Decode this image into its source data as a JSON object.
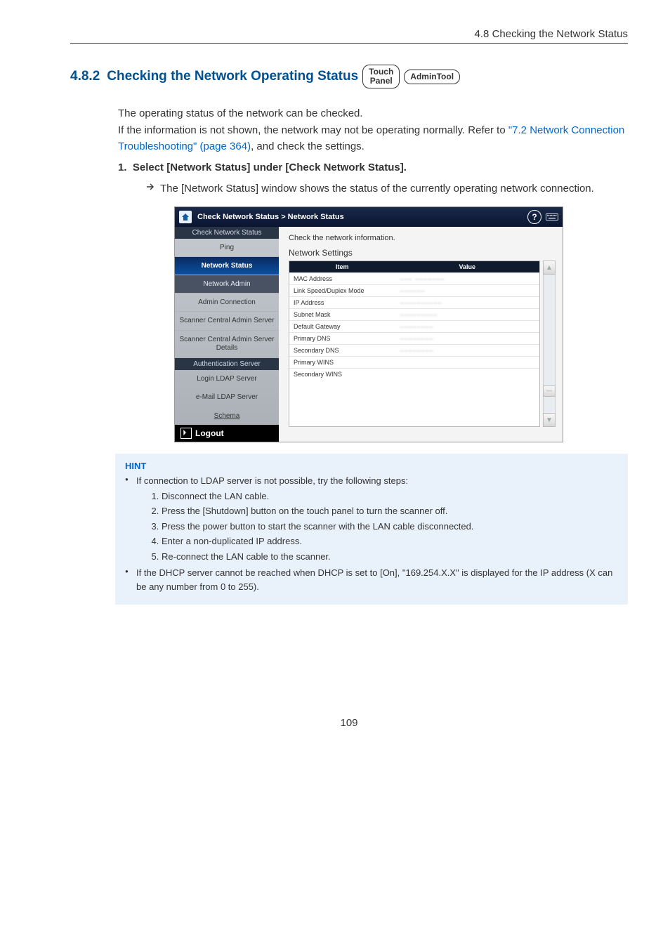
{
  "header_right": "4.8 Checking the Network Status",
  "section": {
    "num": "4.8.2",
    "title": "Checking the Network Operating Status",
    "badge1_line1": "Touch",
    "badge1_line2": "Panel",
    "badge2": "AdminTool"
  },
  "body": {
    "p1": "The operating status of the network can be checked.",
    "p2a": "If the information is not shown, the network may not be operating normally. Refer to ",
    "link": "\"7.2 Network Connection Troubleshooting\" (page 364)",
    "p2b": ", and check the settings."
  },
  "step": {
    "num": "1.",
    "text": "Select [Network Status] under [Check Network Status].",
    "result": "The [Network Status] window shows the status of the currently operating network connection."
  },
  "app": {
    "titlebar": "Check Network Status  >  Network Status",
    "help": "?",
    "sidebar": {
      "group1": "Check Network Status",
      "ping": "Ping",
      "network_status": "Network Status",
      "network_admin": "Network Admin",
      "admin_connection": "Admin Connection",
      "scanner_central_admin_server": "Scanner Central Admin Server",
      "scanner_central_admin_server_details": "Scanner Central Admin Server Details",
      "auth_server": "Authentication Server",
      "login_ldap": "Login LDAP Server",
      "email_ldap": "e-Mail LDAP Server",
      "schema": "Schema",
      "logout": "Logout"
    },
    "content": {
      "msg": "Check the network information.",
      "subhead": "Network Settings",
      "col_item": "Item",
      "col_value": "Value",
      "rows": [
        {
          "item": "MAC Address",
          "value": "––– –––––––"
        },
        {
          "item": "Link Speed/Duplex Mode",
          "value": "––––––"
        },
        {
          "item": "IP Address",
          "value": "––––––––––"
        },
        {
          "item": "Subnet Mask",
          "value": "–––––––––"
        },
        {
          "item": "Default Gateway",
          "value": "––––––––"
        },
        {
          "item": "Primary DNS",
          "value": "––––––––"
        },
        {
          "item": "Secondary DNS",
          "value": "––––––––"
        },
        {
          "item": "Primary WINS",
          "value": ""
        },
        {
          "item": "Secondary WINS",
          "value": ""
        }
      ]
    }
  },
  "hint": {
    "head": "HINT",
    "b1": "If connection to LDAP server is not possible, try the following steps:",
    "n1": "Disconnect the LAN cable.",
    "n2": "Press the [Shutdown] button on the touch panel to turn the scanner off.",
    "n3": "Press the power button to start the scanner with the LAN cable disconnected.",
    "n4": "Enter a non-duplicated IP address.",
    "n5": "Re-connect the LAN cable to the scanner.",
    "b2": "If the DHCP server cannot be reached when DHCP is set to [On], \"169.254.X.X\" is displayed for the IP address (X can be any number from 0 to 255)."
  },
  "pagenum": "109"
}
